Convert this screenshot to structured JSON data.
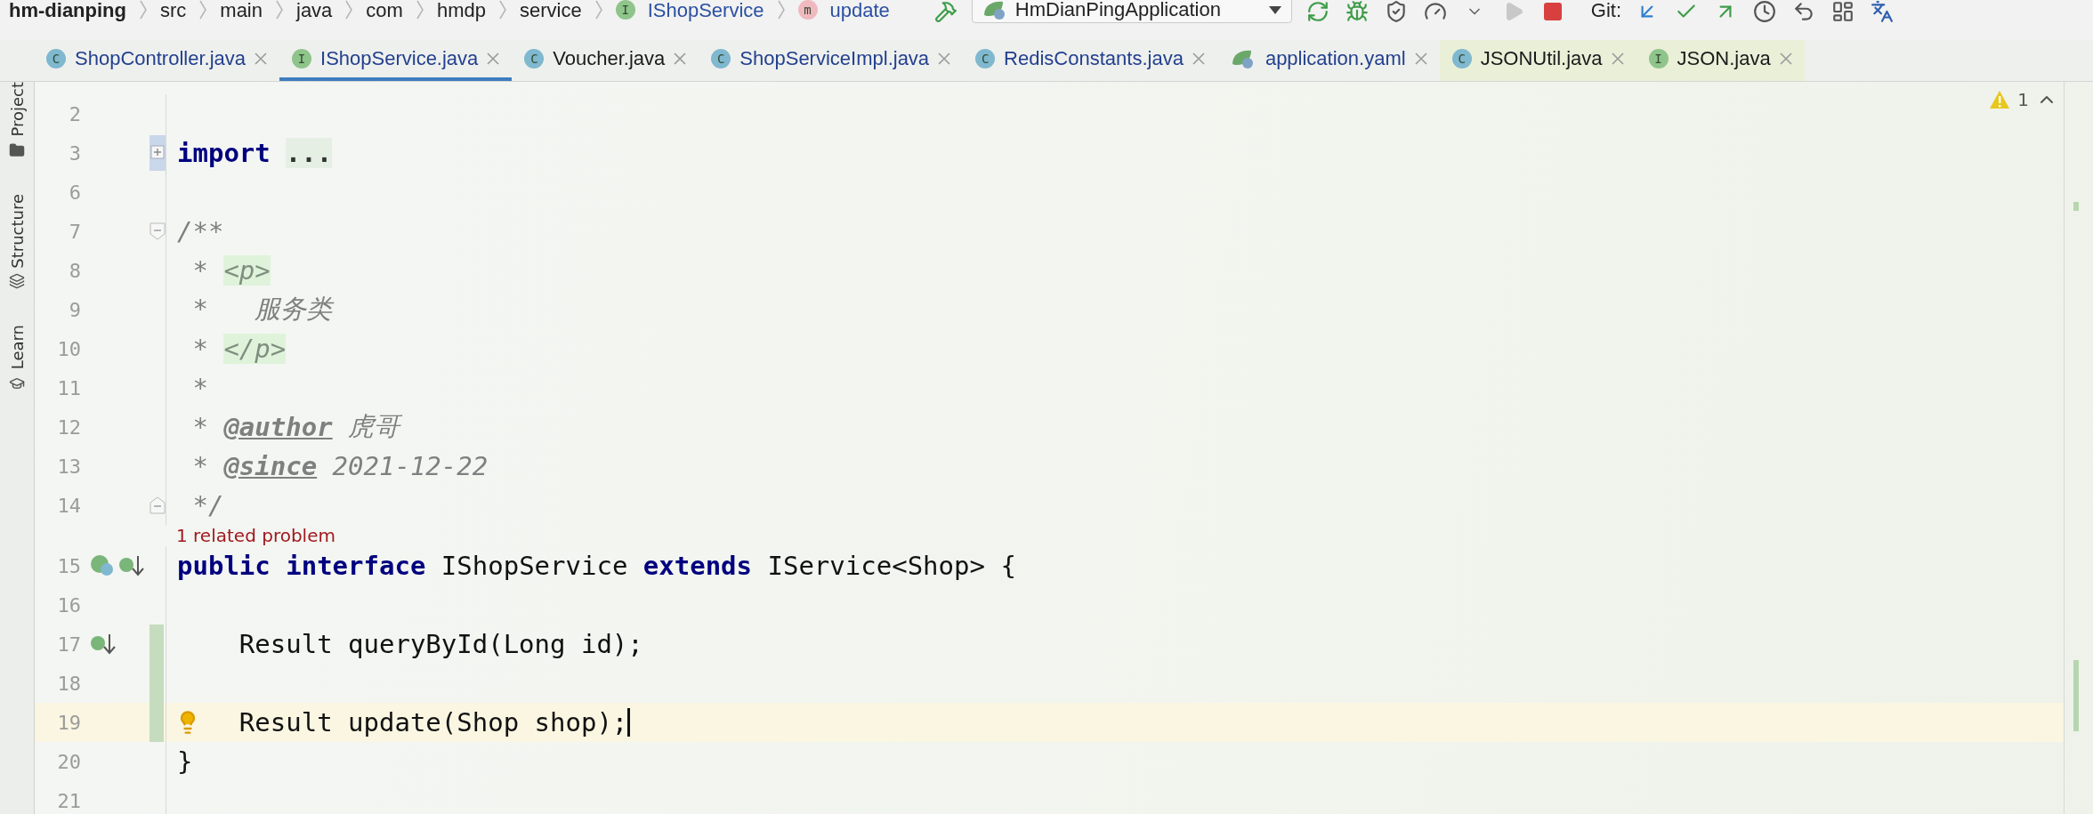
{
  "breadcrumbs": [
    {
      "text": "hm-dianping",
      "kind": "project"
    },
    {
      "text": "src",
      "kind": "folder"
    },
    {
      "text": "main",
      "kind": "folder"
    },
    {
      "text": "java",
      "kind": "folder"
    },
    {
      "text": "com",
      "kind": "folder"
    },
    {
      "text": "hmdp",
      "kind": "folder"
    },
    {
      "text": "service",
      "kind": "folder"
    },
    {
      "text": "IShopService",
      "kind": "interface",
      "letter": "I"
    },
    {
      "text": "update",
      "kind": "method",
      "letter": "m"
    }
  ],
  "run_config": {
    "label": "HmDianPingApplication"
  },
  "vcs": {
    "label": "Git:"
  },
  "tabs": [
    {
      "label": "ShopController.java",
      "kind": "class",
      "letter": "C",
      "selected": false,
      "modified": true,
      "library": false
    },
    {
      "label": "IShopService.java",
      "kind": "interface",
      "letter": "I",
      "selected": true,
      "modified": true,
      "library": false
    },
    {
      "label": "Voucher.java",
      "kind": "class",
      "letter": "C",
      "selected": false,
      "modified": false,
      "library": false
    },
    {
      "label": "ShopServiceImpl.java",
      "kind": "class",
      "letter": "C",
      "selected": false,
      "modified": true,
      "library": false
    },
    {
      "label": "RedisConstants.java",
      "kind": "class",
      "letter": "C",
      "selected": false,
      "modified": true,
      "library": false
    },
    {
      "label": "application.yaml",
      "kind": "spring",
      "selected": false,
      "modified": true,
      "library": false
    },
    {
      "label": "JSONUtil.java",
      "kind": "class",
      "letter": "C",
      "selected": false,
      "modified": false,
      "library": true
    },
    {
      "label": "JSON.java",
      "kind": "interface",
      "letter": "I",
      "selected": false,
      "modified": false,
      "library": true
    }
  ],
  "tool_windows": [
    {
      "label": "Project",
      "kind": "folder"
    },
    {
      "label": "Structure",
      "kind": "structure"
    },
    {
      "label": "Learn",
      "kind": "learn"
    }
  ],
  "inspections": {
    "count": "1"
  },
  "lines": [
    {
      "kind": "code",
      "number": "2"
    },
    {
      "kind": "code",
      "number": "3",
      "fold": {
        "kind": "collapsed"
      },
      "tokens": [
        {
          "kind": "kw",
          "text": "import"
        },
        {
          "kind": "folded",
          "text": "..."
        }
      ]
    },
    {
      "kind": "code",
      "number": "6"
    },
    {
      "kind": "code",
      "number": "7",
      "fold": {
        "kind": "start"
      },
      "tokens": [
        {
          "kind": "comment",
          "text": "/**"
        }
      ]
    },
    {
      "kind": "code",
      "number": "8",
      "tokens": [
        {
          "kind": "comment",
          "text": " * "
        },
        {
          "kind": "html",
          "text": "<p>"
        }
      ]
    },
    {
      "kind": "code",
      "number": "9",
      "tokens": [
        {
          "kind": "comment",
          "text": " *   服务类"
        }
      ]
    },
    {
      "kind": "code",
      "number": "10",
      "tokens": [
        {
          "kind": "comment",
          "text": " * "
        },
        {
          "kind": "html",
          "text": "</p>"
        }
      ]
    },
    {
      "kind": "code",
      "number": "11",
      "tokens": [
        {
          "kind": "comment",
          "text": " *"
        }
      ]
    },
    {
      "kind": "code",
      "number": "12",
      "tokens": [
        {
          "kind": "comment",
          "text": " * "
        },
        {
          "kind": "doctag",
          "text": "@author"
        },
        {
          "kind": "comment",
          "text": " 虎哥"
        }
      ]
    },
    {
      "kind": "code",
      "number": "13",
      "tokens": [
        {
          "kind": "comment",
          "text": " * "
        },
        {
          "kind": "doctag",
          "text": "@since"
        },
        {
          "kind": "comment",
          "text": " 2021-12-22"
        }
      ]
    },
    {
      "kind": "code",
      "number": "14",
      "fold": {
        "kind": "end"
      },
      "tokens": [
        {
          "kind": "comment",
          "text": " */"
        }
      ]
    },
    {
      "kind": "inlay",
      "text": "1 related problem"
    },
    {
      "kind": "code",
      "number": "15",
      "icons": [
        {
          "kind": "bean"
        },
        {
          "kind": "implemented"
        }
      ],
      "tokens": [
        {
          "kind": "kw",
          "text": "public"
        },
        {
          "kind": "kw",
          "text": " interface"
        },
        {
          "kind": "plain",
          "text": " IShopService "
        },
        {
          "kind": "kw",
          "text": "extends"
        },
        {
          "kind": "plain",
          "text": " IService<Shop> {"
        }
      ]
    },
    {
      "kind": "code",
      "number": "16"
    },
    {
      "kind": "code",
      "number": "17",
      "icons": [
        {
          "kind": "implemented"
        }
      ],
      "changed": true,
      "tokens": [
        {
          "kind": "plain",
          "text": "    Result queryById(Long id);"
        }
      ]
    },
    {
      "kind": "code",
      "number": "18",
      "changed": true
    },
    {
      "kind": "code",
      "number": "19",
      "changed": true,
      "current": true,
      "bulb": true,
      "caret": true,
      "tokens": [
        {
          "kind": "plain",
          "text": "    Result update(Shop shop);"
        }
      ]
    },
    {
      "kind": "code",
      "number": "20",
      "tokens": [
        {
          "kind": "plain",
          "text": "}"
        }
      ]
    },
    {
      "kind": "code",
      "number": "21"
    }
  ]
}
